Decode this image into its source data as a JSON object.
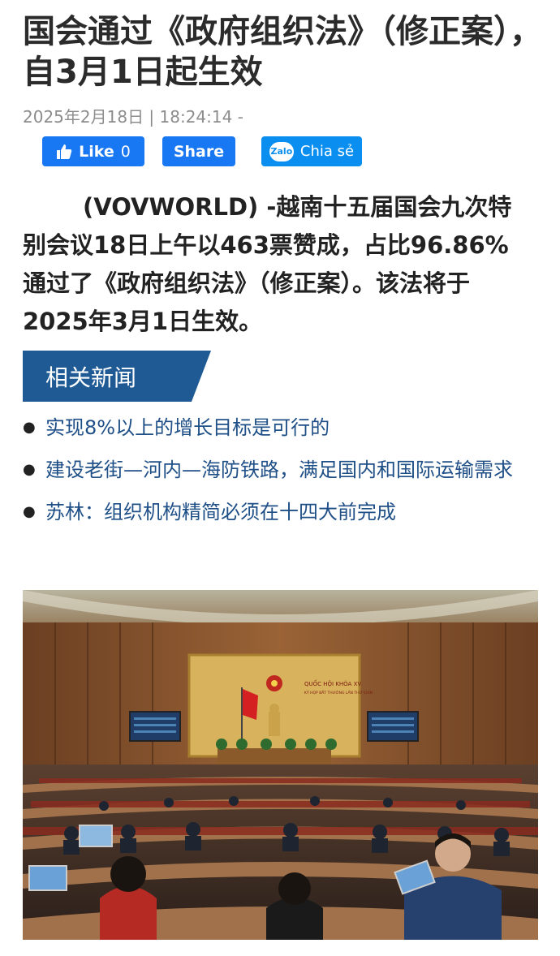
{
  "article": {
    "title": "国会通过《政府组织法》（修正案），自3月1日起生效",
    "meta": "2025年2月18日 | 18:24:14 -",
    "lead_intro": "(VOVWORLD) -",
    "lead_body": "越南十五届国会九次特别会议18日上午以463票赞成，占比96.86% 通过了《政府组织法》（修正案）。该法将于2025年3月1日生效。"
  },
  "share": {
    "like_label": "Like",
    "like_count": "0",
    "share_label": "Share",
    "zalo_logo": "Zalo",
    "zalo_label": "Chia sẻ"
  },
  "related": {
    "title": "相关新闻",
    "items": [
      "实现8%以上的增长目标是可行的",
      "建设老街—河内—海防铁路，满足国内和国际运输需求",
      "苏林：组织机构精简必须在十四大前完成"
    ]
  },
  "photo": {
    "screen_text": "QUỐC HỘI KHÓA XV",
    "screen_subtext": "KỲ HỌP BẤT THƯỜNG LẦN THỨ CHÍN"
  },
  "colors": {
    "facebook_blue": "#1877f2",
    "zalo_blue": "#0a8ff0",
    "related_header_bg": "#1f5a94",
    "related_link": "#1f4f87",
    "meta_gray": "#8c8c8c"
  },
  "icons": [
    "thumbs-up-icon",
    "zalo-logo-icon",
    "bullet-icon"
  ]
}
